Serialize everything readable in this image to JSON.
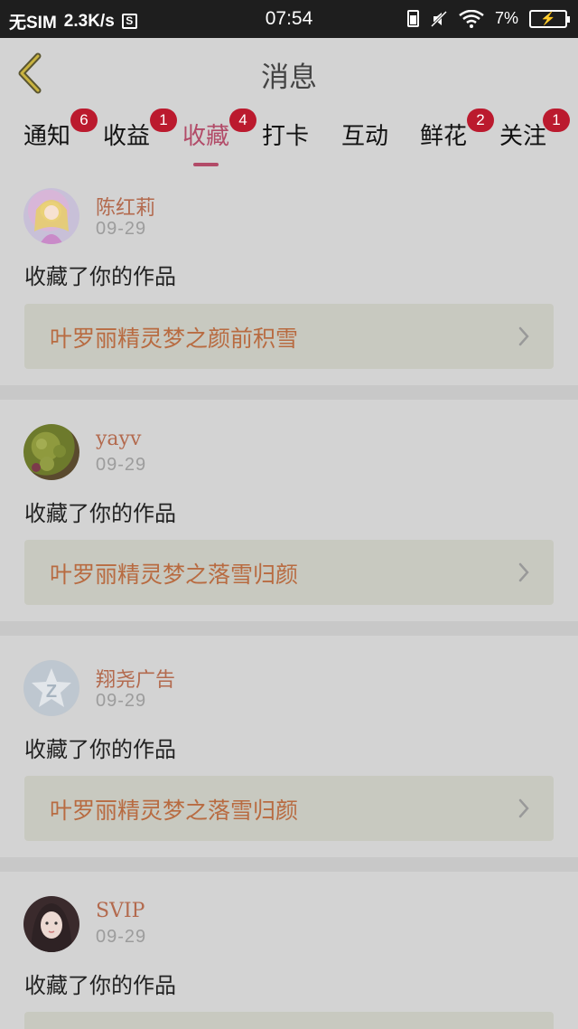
{
  "status_bar": {
    "carrier": "无SIM",
    "speed": "2.3K/s",
    "sim_icon_text": "S",
    "time": "07:54",
    "battery_percent": "7%"
  },
  "header": {
    "title": "消息"
  },
  "tabs": [
    {
      "label": "通知",
      "badge": "6"
    },
    {
      "label": "收益",
      "badge": "1"
    },
    {
      "label": "收藏",
      "badge": "4",
      "active": true
    },
    {
      "label": "打卡",
      "badge": ""
    },
    {
      "label": "互动",
      "badge": ""
    },
    {
      "label": "鲜花",
      "badge": "2"
    },
    {
      "label": "关注",
      "badge": "1"
    }
  ],
  "messages": [
    {
      "user": "陈红莉",
      "date": "09-29",
      "action": "收藏了你的作品",
      "work": "叶罗丽精灵梦之颜前积雪",
      "avatar": "anime-doll-avatar"
    },
    {
      "user": "yayv",
      "date": "09-29",
      "action": "收藏了你的作品",
      "work": "叶罗丽精灵梦之落雪归颜",
      "avatar": "moss-avatar"
    },
    {
      "user": "翔尧广告",
      "date": "09-29",
      "action": "收藏了你的作品",
      "work": "叶罗丽精灵梦之落雪归颜",
      "avatar": "default-star-avatar"
    },
    {
      "user": "SVIP",
      "date": "09-29",
      "action": "收藏了你的作品",
      "work": "",
      "avatar": "girl-photo-avatar"
    }
  ],
  "colors": {
    "accent": "#b24b68",
    "badge": "#bb1a2e",
    "username": "#b36a4e",
    "work_title": "#b86b41"
  }
}
